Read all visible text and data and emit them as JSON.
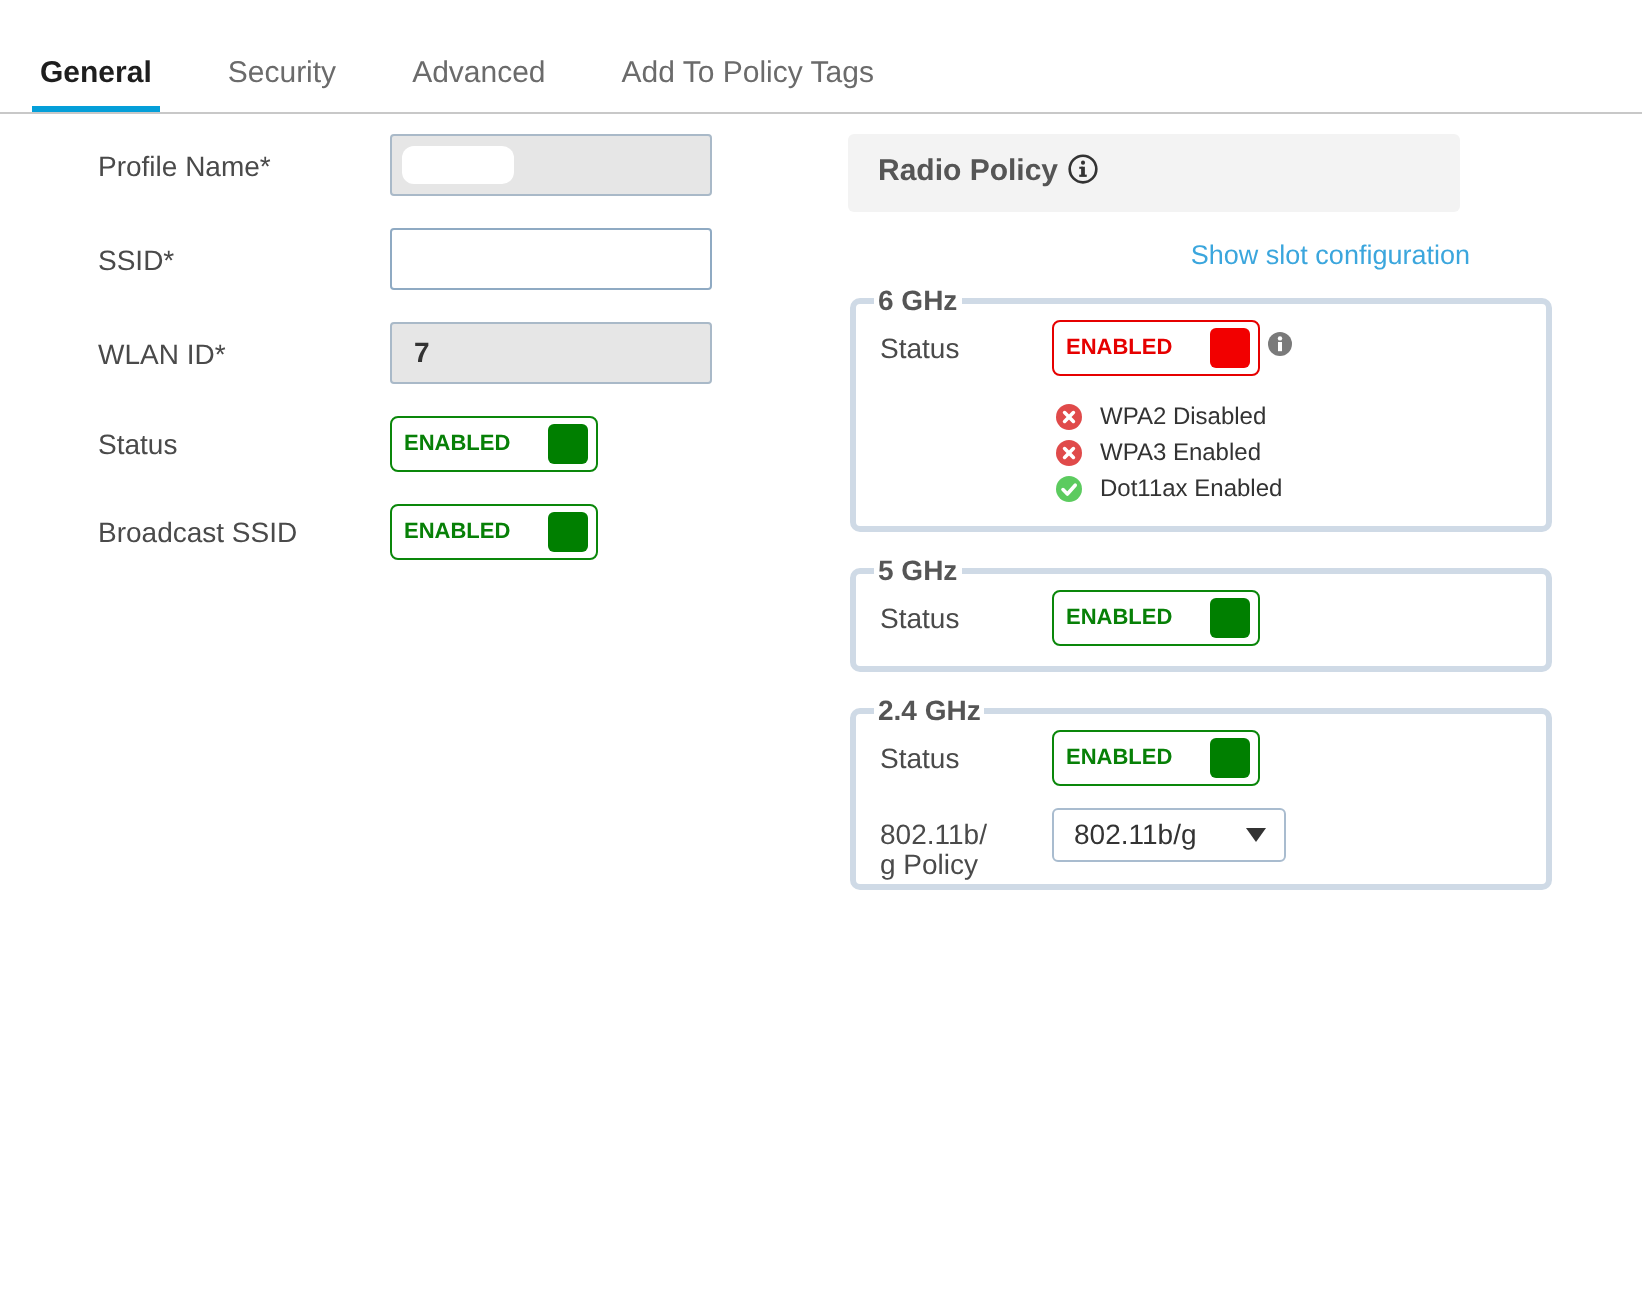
{
  "tabs": [
    {
      "label": "General",
      "selected": true
    },
    {
      "label": "Security",
      "selected": false
    },
    {
      "label": "Advanced",
      "selected": false
    },
    {
      "label": "Add To Policy Tags",
      "selected": false
    }
  ],
  "general": {
    "fields": [
      {
        "kind": "text",
        "label": "Profile Name*",
        "disabled": true,
        "redacted": true
      },
      {
        "kind": "text",
        "label": "SSID*",
        "disabled": false,
        "redacted": false
      },
      {
        "kind": "text",
        "label": "WLAN ID*",
        "value": "7",
        "disabled": true,
        "redacted": false
      },
      {
        "kind": "toggle",
        "label": "Status",
        "text": "ENABLED",
        "on": true,
        "alert": false,
        "info": false
      },
      {
        "kind": "toggle",
        "label": "Broadcast SSID",
        "text": "ENABLED",
        "on": true,
        "alert": false,
        "info": false
      }
    ]
  },
  "radio_policy": {
    "title": "Radio Policy",
    "slot_link": "Show slot configuration",
    "bands": [
      {
        "name": "6 GHz",
        "rows": [
          {
            "kind": "toggle",
            "label": "Status",
            "text": "ENABLED",
            "on": true,
            "alert": true,
            "info": true
          }
        ],
        "checks": [
          {
            "text": "WPA2 Disabled",
            "ok": false
          },
          {
            "text": "WPA3 Enabled",
            "ok": false
          },
          {
            "text": "Dot11ax Enabled",
            "ok": true
          }
        ]
      },
      {
        "name": "5 GHz",
        "rows": [
          {
            "kind": "toggle",
            "label": "Status",
            "text": "ENABLED",
            "on": true,
            "alert": false,
            "info": false
          }
        ]
      },
      {
        "name": "2.4 GHz",
        "rows": [
          {
            "kind": "toggle",
            "label": "Status",
            "text": "ENABLED",
            "on": true,
            "alert": false,
            "info": false
          },
          {
            "kind": "select",
            "label": "802.11b/g Policy",
            "value": "802.11b/g"
          }
        ]
      }
    ]
  }
}
